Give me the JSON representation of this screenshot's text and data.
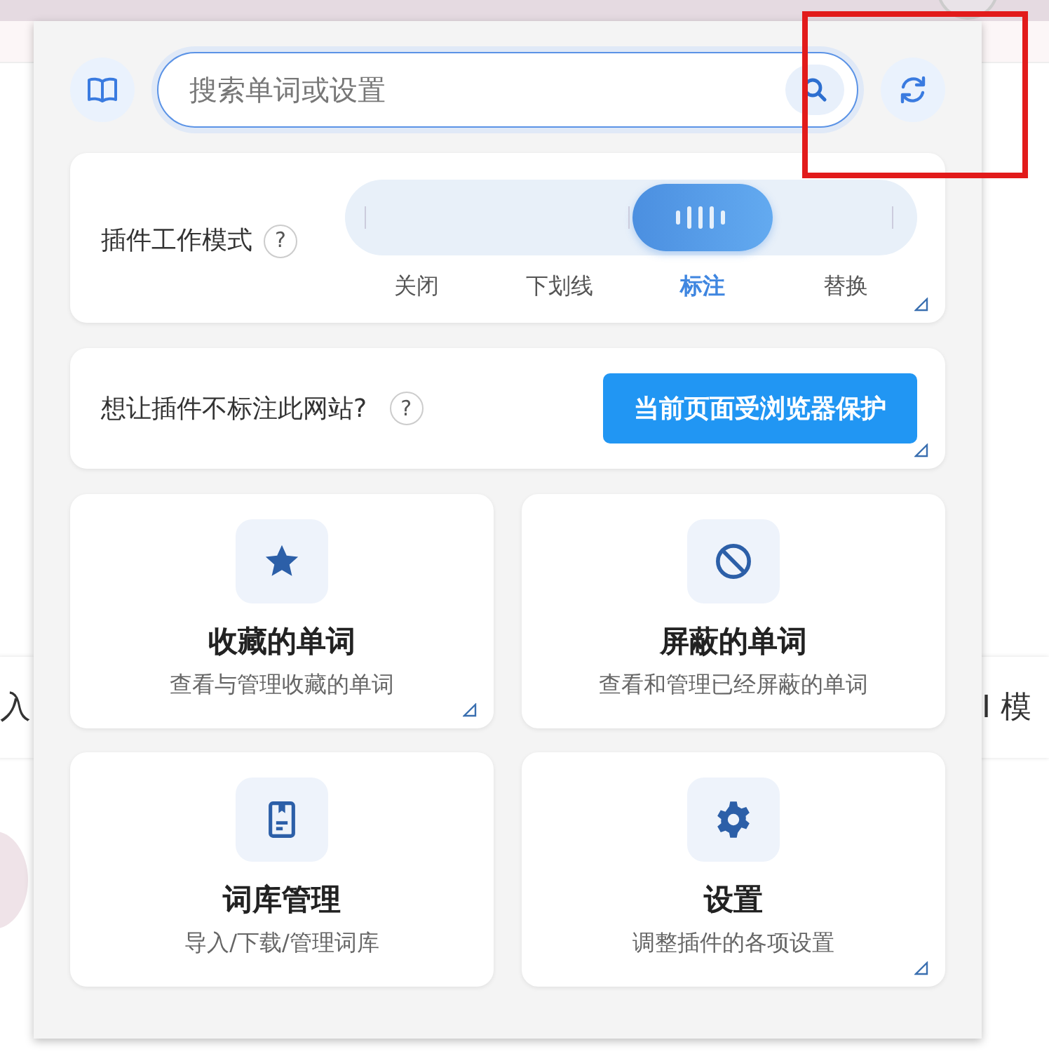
{
  "background": {
    "fragments": [
      "入",
      "I 模"
    ]
  },
  "search": {
    "placeholder": "搜索单词或设置"
  },
  "mode": {
    "label": "插件工作模式",
    "help": "?",
    "corner_mark": true,
    "options": [
      {
        "label": "关闭",
        "selected": false
      },
      {
        "label": "下划线",
        "selected": false
      },
      {
        "label": "标注",
        "selected": true
      },
      {
        "label": "替换",
        "selected": false
      }
    ]
  },
  "site": {
    "label": "想让插件不标注此网站?",
    "help": "?",
    "button": "当前页面受浏览器保护",
    "corner_mark": true
  },
  "tiles": [
    {
      "kind": "star",
      "title": "收藏的单词",
      "subtitle": "查看与管理收藏的单词",
      "corner_mark": true
    },
    {
      "kind": "block",
      "title": "屏蔽的单词",
      "subtitle": "查看和管理已经屏蔽的单词",
      "corner_mark": false
    },
    {
      "kind": "book",
      "title": "词库管理",
      "subtitle": "导入/下载/管理词库",
      "corner_mark": false
    },
    {
      "kind": "gear",
      "title": "设置",
      "subtitle": "调整插件的各项设置",
      "corner_mark": true
    }
  ]
}
